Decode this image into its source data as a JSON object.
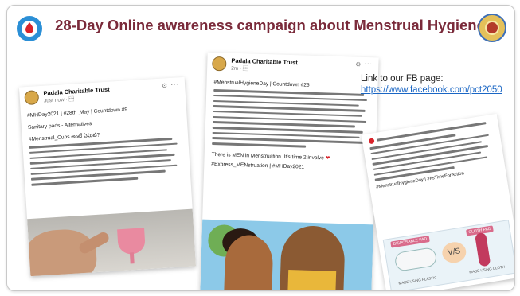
{
  "title": "28-Day Online awareness campaign about Menstrual Hygiene",
  "link": {
    "label": "Link to our FB page:",
    "url": "https://www.facebook.com/pct2050"
  },
  "post_left": {
    "author": "Padala Charitable Trust",
    "time": "Just now · \u0001",
    "hashtags": "#MHDay2021 | #28th_May | Countdown #9",
    "subtitle": "Sanitary pads - Alternatives",
    "tag_line": "#Menstrual_Cups అంటే ఏమిటి?",
    "body_lines": 8,
    "image": "menstrual-cup-in-hand"
  },
  "post_middle": {
    "author": "Padala Charitable Trust",
    "time": "2m · \u0001",
    "hashtags": "#MenstrualHygieneDay | Countdown #26",
    "body_lines": 11,
    "closing": "There is MEN in Menstruation. It's time 2 involve",
    "footer_tags": "#Express_MENstruation | #MHDay2021",
    "image": "father-and-daughter-illustration"
  },
  "post_right": {
    "body_lines": 5,
    "footer_tags": "#MenstrualHygieneDay | #ItsTimeForAction",
    "left_label": "DISPOSABLE PAD",
    "right_label": "CLOTH PAD",
    "left_caption": "MADE USING PLASTIC",
    "right_caption": "MADE USING CLOTH",
    "vs": "V/S"
  },
  "colors": {
    "title": "#7a2a3a",
    "link": "#1a66c4",
    "hashtag": "#3a63b5"
  },
  "icons": [
    "blood-drop-logo-icon",
    "trust-seal-icon",
    "globe-icon",
    "more-options-icon",
    "heart-emoji-icon"
  ]
}
